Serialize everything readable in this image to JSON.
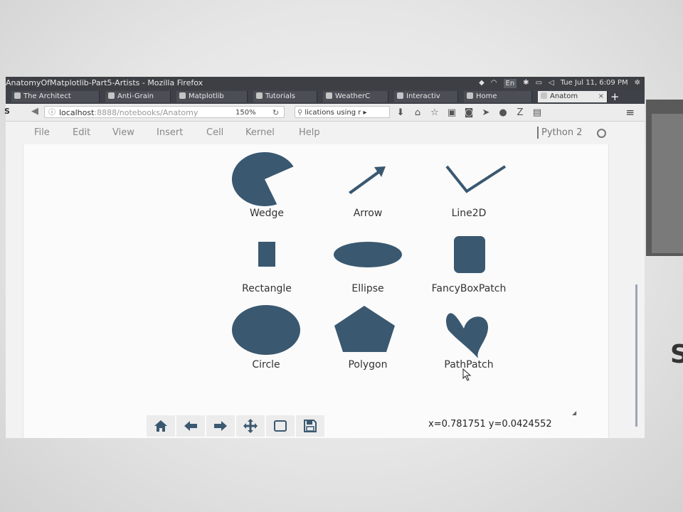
{
  "window": {
    "title": "AnatomyOfMatplotlib-Part5-Artists - Mozilla Firefox",
    "language": "En",
    "clock": "Tue Jul 11, 6:09 PM"
  },
  "tabs": [
    {
      "label": "The Architect"
    },
    {
      "label": "Anti-Grain"
    },
    {
      "label": "Matplotlib"
    },
    {
      "label": "Tutorials"
    },
    {
      "label": "WeatherC"
    },
    {
      "label": "Interactiv"
    },
    {
      "label": "Home"
    },
    {
      "label": "Anatom"
    }
  ],
  "navbar": {
    "badge": "S",
    "url_host": "localhost",
    "url_port_path": ":8888/notebooks/Anatomy",
    "zoom": "150%",
    "search_text": "lications using r"
  },
  "menu": [
    "File",
    "Edit",
    "View",
    "Insert",
    "Cell",
    "Kernel",
    "Help"
  ],
  "kernel": "Python 2",
  "artists": [
    "Wedge",
    "Arrow",
    "Line2D",
    "Rectangle",
    "Ellipse",
    "FancyBoxPatch",
    "Circle",
    "Polygon",
    "PathPatch"
  ],
  "status": {
    "coordinates": "x=0.781751 y=0.0424552"
  },
  "colors": {
    "shape_fill": "#3a5870",
    "tab_bar": "#3e4147",
    "figure_bg": "#fbfbfb"
  },
  "icons": [
    "home-icon",
    "back-arrow-icon",
    "forward-arrow-icon",
    "pan-icon",
    "zoom-rect-icon",
    "save-icon"
  ]
}
